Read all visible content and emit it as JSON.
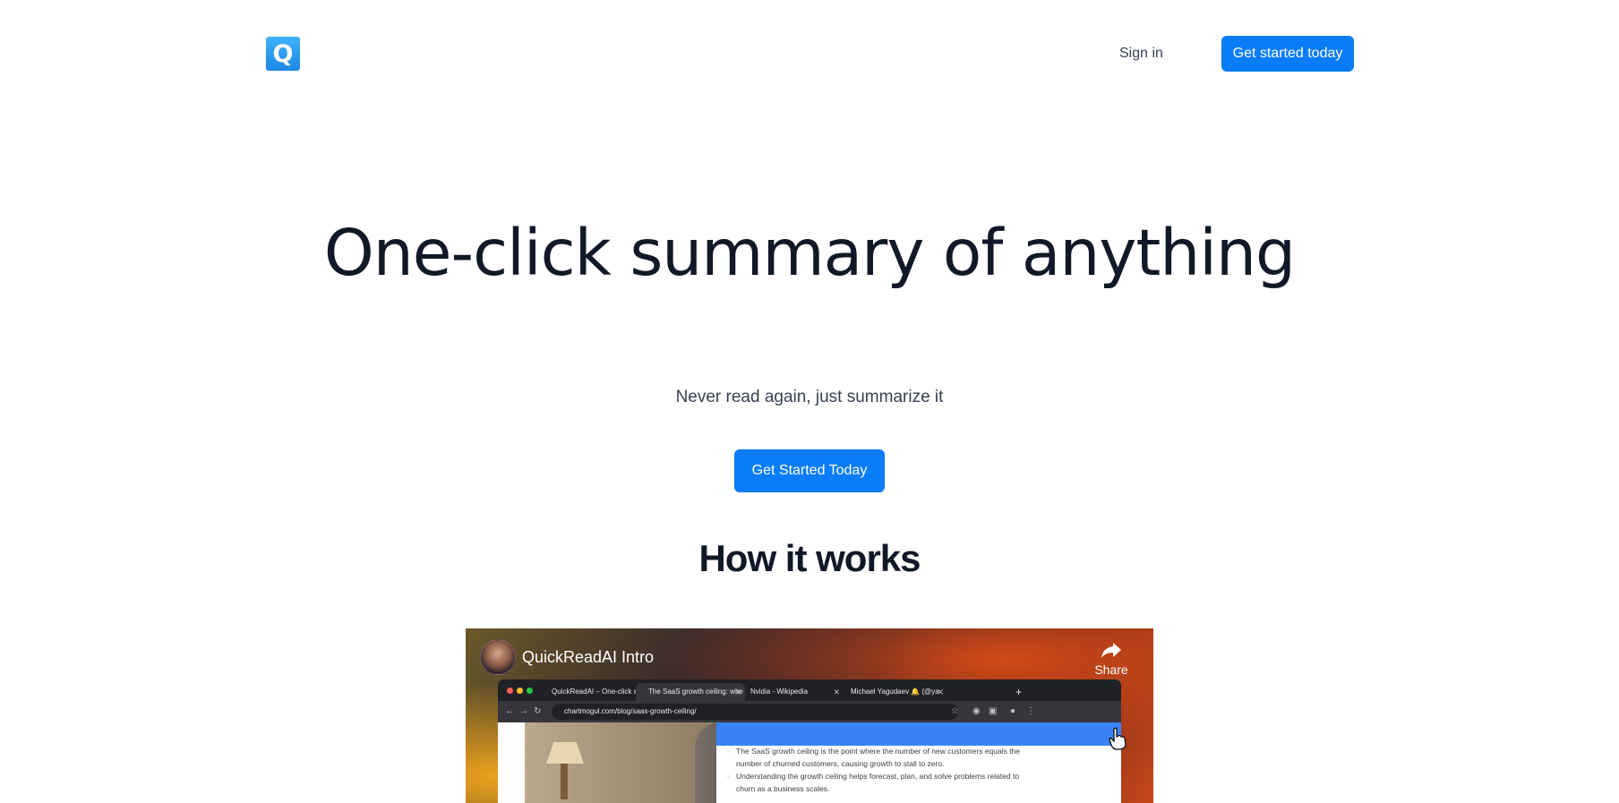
{
  "header": {
    "logo_letter": "Q",
    "signin_label": "Sign in",
    "cta_label": "Get started today"
  },
  "hero": {
    "title": "One-click summary of anything",
    "subtitle": "Never read again, just summarize it",
    "cta_label": "Get Started Today"
  },
  "how_it_works": {
    "title": "How it works"
  },
  "video": {
    "title": "QuickReadAI Intro",
    "share_label": "Share",
    "browser": {
      "tabs": [
        "QuickReadAI – One-click sum",
        "The SaaS growth ceiling: whe",
        "Nvidia - Wikipedia",
        "Michael Yagudaev 🔔 (@ya"
      ],
      "new_tab": "+",
      "url": "chartmogul.com/blog/saas-growth-ceiling/",
      "summary_bullets": [
        "The SaaS growth ceiling is the point where the number of new customers equals the number of churned customers, causing growth to stall to zero.",
        "Understanding the growth ceiling helps forecast, plan, and solve problems related to churn as a business scales."
      ]
    }
  }
}
